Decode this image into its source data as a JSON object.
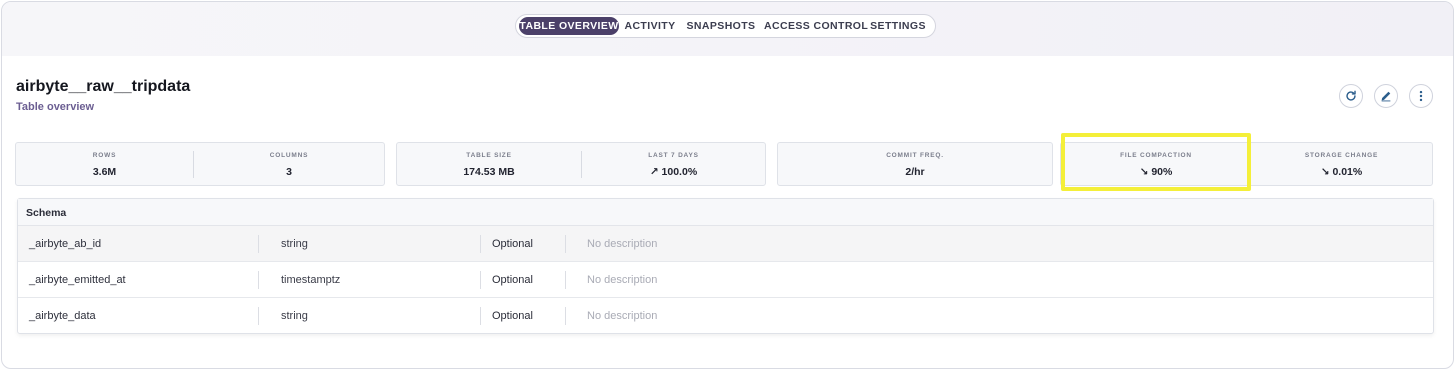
{
  "tabs": [
    {
      "label": "TABLE OVERVIEW",
      "active": true
    },
    {
      "label": "ACTIVITY",
      "active": false
    },
    {
      "label": "SNAPSHOTS",
      "active": false
    },
    {
      "label": "ACCESS CONTROL",
      "active": false
    },
    {
      "label": "SETTINGS",
      "active": false
    }
  ],
  "header": {
    "title": "airbyte__raw__tripdata",
    "subtitle": "Table overview"
  },
  "actions": {
    "icons": [
      "refresh-icon",
      "edit-icon",
      "more-vertical-icon"
    ]
  },
  "stats": {
    "rows": {
      "label": "ROWS",
      "value": "3.6M"
    },
    "columns": {
      "label": "COLUMNS",
      "value": "3"
    },
    "table_size": {
      "label": "TABLE SIZE",
      "value": "174.53 MB"
    },
    "last_7_days": {
      "label": "LAST 7 DAYS",
      "value": "↗ 100.0%"
    },
    "commit_freq": {
      "label": "COMMIT FREQ.",
      "value": "2/hr"
    },
    "file_compaction": {
      "label": "FILE COMPACTION",
      "value": "↘ 90%"
    },
    "storage_change": {
      "label": "STORAGE CHANGE",
      "value": "↘ 0.01%"
    }
  },
  "schema": {
    "title": "Schema",
    "rows": [
      {
        "name": "_airbyte_ab_id",
        "type": "string",
        "required": "Optional",
        "description": "No description"
      },
      {
        "name": "_airbyte_emitted_at",
        "type": "timestamptz",
        "required": "Optional",
        "description": "No description"
      },
      {
        "name": "_airbyte_data",
        "type": "string",
        "required": "Optional",
        "description": "No description"
      }
    ]
  },
  "colors": {
    "accent": "#4b4069",
    "highlight": "#f4ef39",
    "subtitle": "#6b5e92"
  }
}
